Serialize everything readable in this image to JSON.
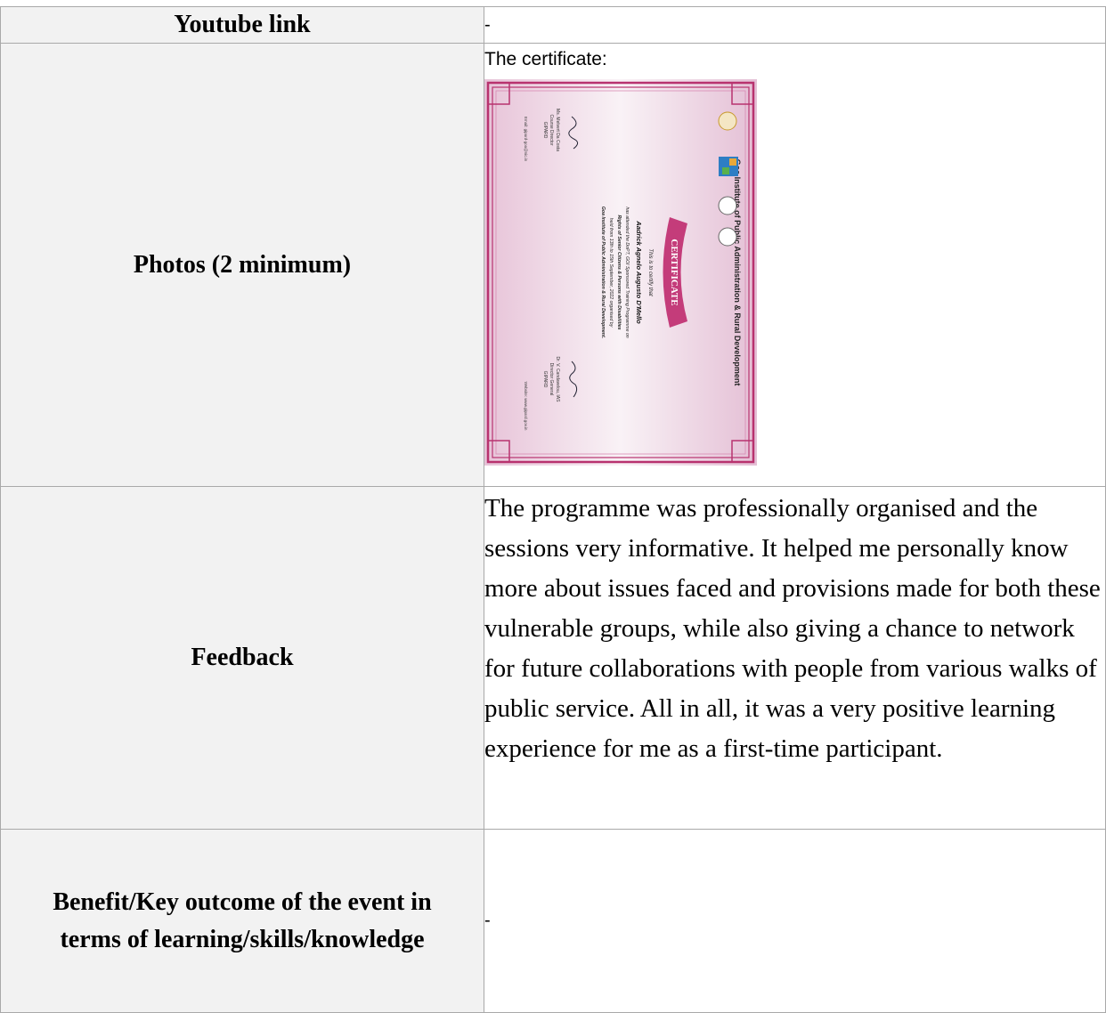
{
  "rows": {
    "youtube": {
      "label": "Youtube link",
      "value": "-"
    },
    "photos": {
      "label": "Photos (2 minimum)",
      "caption": "The certificate:",
      "certificate": {
        "institute": "Goa Institute of Public Administration & Rural Development",
        "heading": "CERTIFICATE",
        "intro": "This is to certify that",
        "name": "Aadrick Agnelo Augusto D'Mello",
        "line1": "has attended the DoPT, GOI Sponsored Training Programme on",
        "line2": "Rights of Senior Citizens & Persons with Disabilities",
        "line3": "held from 13th to 15th September, 2022 organised by",
        "line4": "Goa Institute of Public Administration & Rural Development.",
        "sig_left_name": "Ms. Melvert Da Costa",
        "sig_left_role": "Course Director",
        "sig_left_org": "GIPARD",
        "sig_right_name": "Dr. V. Candavelou, IAS",
        "sig_right_role": "Director General",
        "sig_right_org": "GIPARD",
        "footer_email": "Email: gipard-goa@nic.in",
        "footer_web": "Website: www.gipard.gov.in",
        "logo_text": "GIPARD"
      }
    },
    "feedback": {
      "label": "Feedback",
      "text": "The programme was professionally organised and the sessions very informative. It helped me personally know more about issues faced and provisions made for both these vulnerable groups, while also giving a chance to network for future collaborations with people from various walks of public service. All in all, it was a very positive learning experience for me as a first-time participant."
    },
    "benefit": {
      "label_line1": "Benefit/Key outcome of the event in",
      "label_line2": "terms of learning/skills/knowledge",
      "value": "-"
    }
  },
  "colors": {
    "border": "#a9a9a9",
    "label_bg": "#f2f2f2",
    "cert_frame": "#b8326f",
    "cert_ribbon": "#c43c7a"
  }
}
